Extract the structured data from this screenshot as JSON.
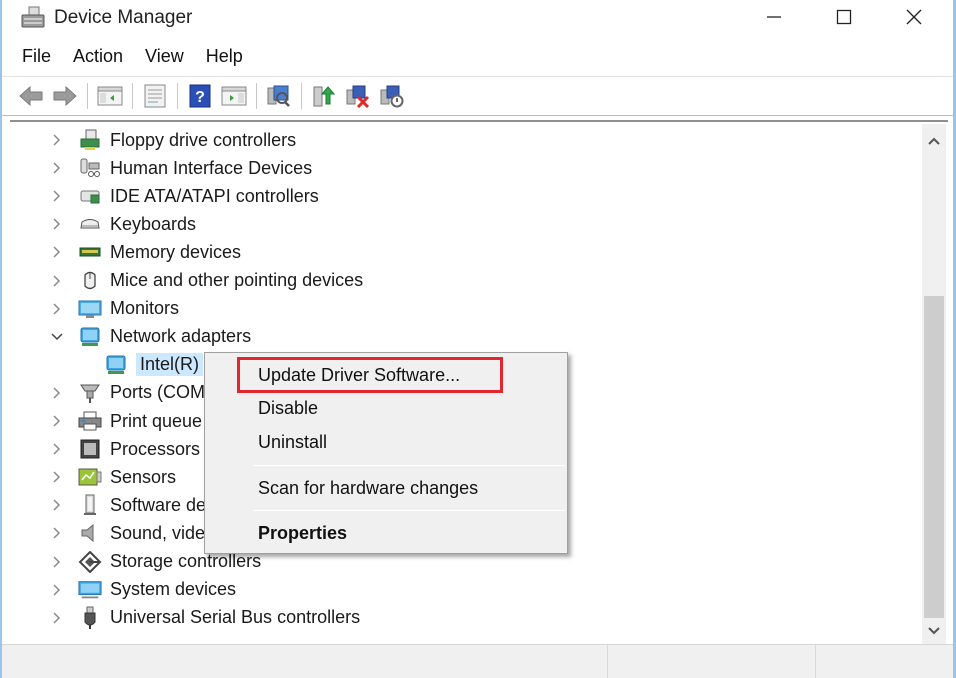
{
  "window": {
    "title": "Device Manager",
    "controls": {
      "minimize": "minimize",
      "maximize": "maximize",
      "close": "close"
    }
  },
  "menubar": {
    "items": [
      "File",
      "Action",
      "View",
      "Help"
    ]
  },
  "toolbar": {
    "buttons": [
      {
        "name": "back",
        "icon": "arrow-left-icon"
      },
      {
        "name": "forward",
        "icon": "arrow-right-icon"
      },
      {
        "name": "show-hide-console-tree",
        "icon": "console-tree-icon"
      },
      {
        "name": "properties",
        "icon": "properties-sheet-icon"
      },
      {
        "name": "help",
        "icon": "help-icon"
      },
      {
        "name": "show-hide-action-pane",
        "icon": "action-pane-icon"
      },
      {
        "name": "scan-hardware",
        "icon": "scan-hardware-icon"
      },
      {
        "name": "update-driver",
        "icon": "update-driver-icon"
      },
      {
        "name": "uninstall-device",
        "icon": "uninstall-device-icon"
      },
      {
        "name": "enable-device",
        "icon": "enable-device-icon"
      }
    ]
  },
  "tree": {
    "nodes": [
      {
        "label": "Floppy drive controllers",
        "expanded": false,
        "icon": "floppy-controller-icon"
      },
      {
        "label": "Human Interface Devices",
        "expanded": false,
        "icon": "hid-icon"
      },
      {
        "label": "IDE ATA/ATAPI controllers",
        "expanded": false,
        "icon": "ide-controller-icon"
      },
      {
        "label": "Keyboards",
        "expanded": false,
        "icon": "keyboard-icon"
      },
      {
        "label": "Memory devices",
        "expanded": false,
        "icon": "memory-icon"
      },
      {
        "label": "Mice and other pointing devices",
        "expanded": false,
        "icon": "mouse-icon"
      },
      {
        "label": "Monitors",
        "expanded": false,
        "icon": "monitor-icon"
      },
      {
        "label": "Network adapters",
        "expanded": true,
        "icon": "network-adapter-icon",
        "children": [
          {
            "label": "Intel(R) ",
            "selected": true,
            "icon": "network-adapter-icon"
          }
        ]
      },
      {
        "label": "Ports (COM",
        "expanded": false,
        "icon": "ports-icon"
      },
      {
        "label": "Print queue",
        "expanded": false,
        "icon": "printer-icon"
      },
      {
        "label": "Processors",
        "expanded": false,
        "icon": "processor-icon"
      },
      {
        "label": "Sensors",
        "expanded": false,
        "icon": "sensor-icon"
      },
      {
        "label": "Software de",
        "expanded": false,
        "icon": "software-device-icon"
      },
      {
        "label": "Sound, vide",
        "expanded": false,
        "icon": "speaker-icon"
      },
      {
        "label": "Storage controllers",
        "expanded": false,
        "icon": "storage-controller-icon"
      },
      {
        "label": "System devices",
        "expanded": false,
        "icon": "system-device-icon"
      },
      {
        "label": "Universal Serial Bus controllers",
        "expanded": false,
        "icon": "usb-icon"
      }
    ]
  },
  "context_menu": {
    "items": [
      {
        "label": "Update Driver Software...",
        "highlighted": true
      },
      {
        "label": "Disable"
      },
      {
        "label": "Uninstall"
      },
      {
        "separator": true
      },
      {
        "label": "Scan for hardware changes"
      },
      {
        "separator": true
      },
      {
        "label": "Properties",
        "bold": true
      }
    ],
    "highlight_color": "#e0262f"
  },
  "colors": {
    "window_border": "#9cc4e8",
    "selection": "#cce8ff",
    "menu_bg": "#f0f0f0"
  }
}
